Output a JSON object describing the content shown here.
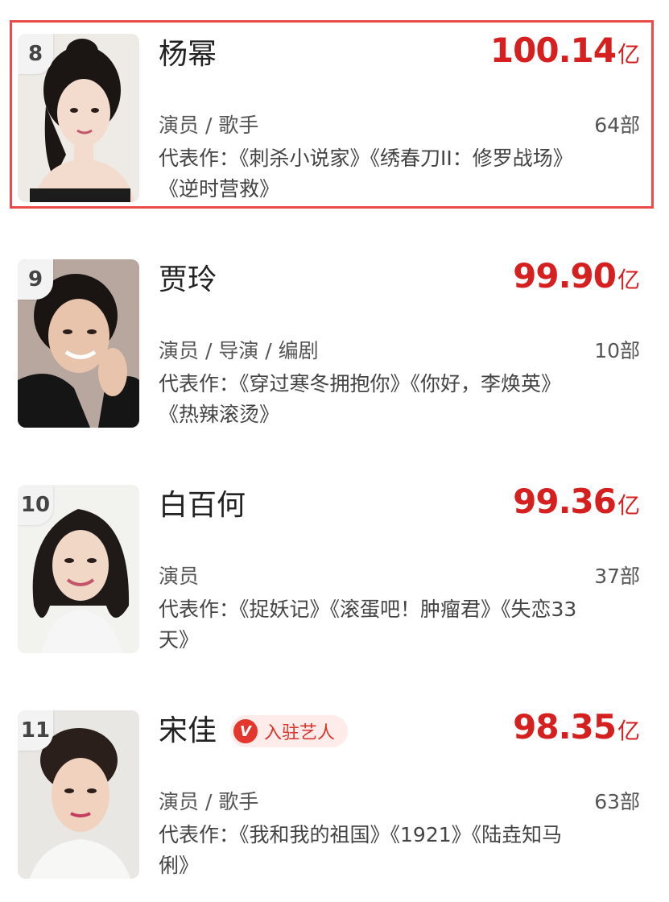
{
  "ranking": [
    {
      "rank": "8",
      "name": "杨幂",
      "boxoffice": "100.14",
      "unit": "亿",
      "roles": "演员 / 歌手",
      "works": "64部",
      "representative": "代表作：《刺杀小说家》《绣春刀II：修罗战场》《逆时营救》",
      "highlighted": true,
      "photo_palette": {
        "bg": "#eeeae6",
        "hair": "#1b1513",
        "skin": "#f3dccd",
        "cloth": "#1c1c1c"
      }
    },
    {
      "rank": "9",
      "name": "贾玲",
      "boxoffice": "99.90",
      "unit": "亿",
      "roles": "演员 / 导演 / 编剧",
      "works": "10部",
      "representative": "代表作：《穿过寒冬拥抱你》《你好，李焕英》《热辣滚烫》",
      "highlighted": false,
      "photo_palette": {
        "bg": "#b7a79f",
        "hair": "#1a1412",
        "skin": "#e8c4ad",
        "cloth": "#151515"
      }
    },
    {
      "rank": "10",
      "name": "白百何",
      "boxoffice": "99.36",
      "unit": "亿",
      "roles": "演员",
      "works": "37部",
      "representative": "代表作：《捉妖记》《滚蛋吧！肿瘤君》《失恋33天》",
      "highlighted": false,
      "photo_palette": {
        "bg": "#f2f2ef",
        "hair": "#1f1a18",
        "skin": "#f1d7c6",
        "cloth": "#f6f6f6"
      }
    },
    {
      "rank": "11",
      "name": "宋佳",
      "badge": "入驻艺人",
      "badge_icon": "V",
      "boxoffice": "98.35",
      "unit": "亿",
      "roles": "演员 / 歌手",
      "works": "63部",
      "representative": "代表作：《我和我的祖国》《1921》《陆垚知马俐》",
      "highlighted": false,
      "photo_palette": {
        "bg": "#e9e7e3",
        "hair": "#2a1f1a",
        "skin": "#f0d2bf",
        "cloth": "#f7f7f5"
      }
    }
  ],
  "colors": {
    "accent": "#d61f1f",
    "highlight_border": "#e94b4b",
    "badge_bg": "#fdecea",
    "badge_icon_bg": "#e3362c"
  }
}
